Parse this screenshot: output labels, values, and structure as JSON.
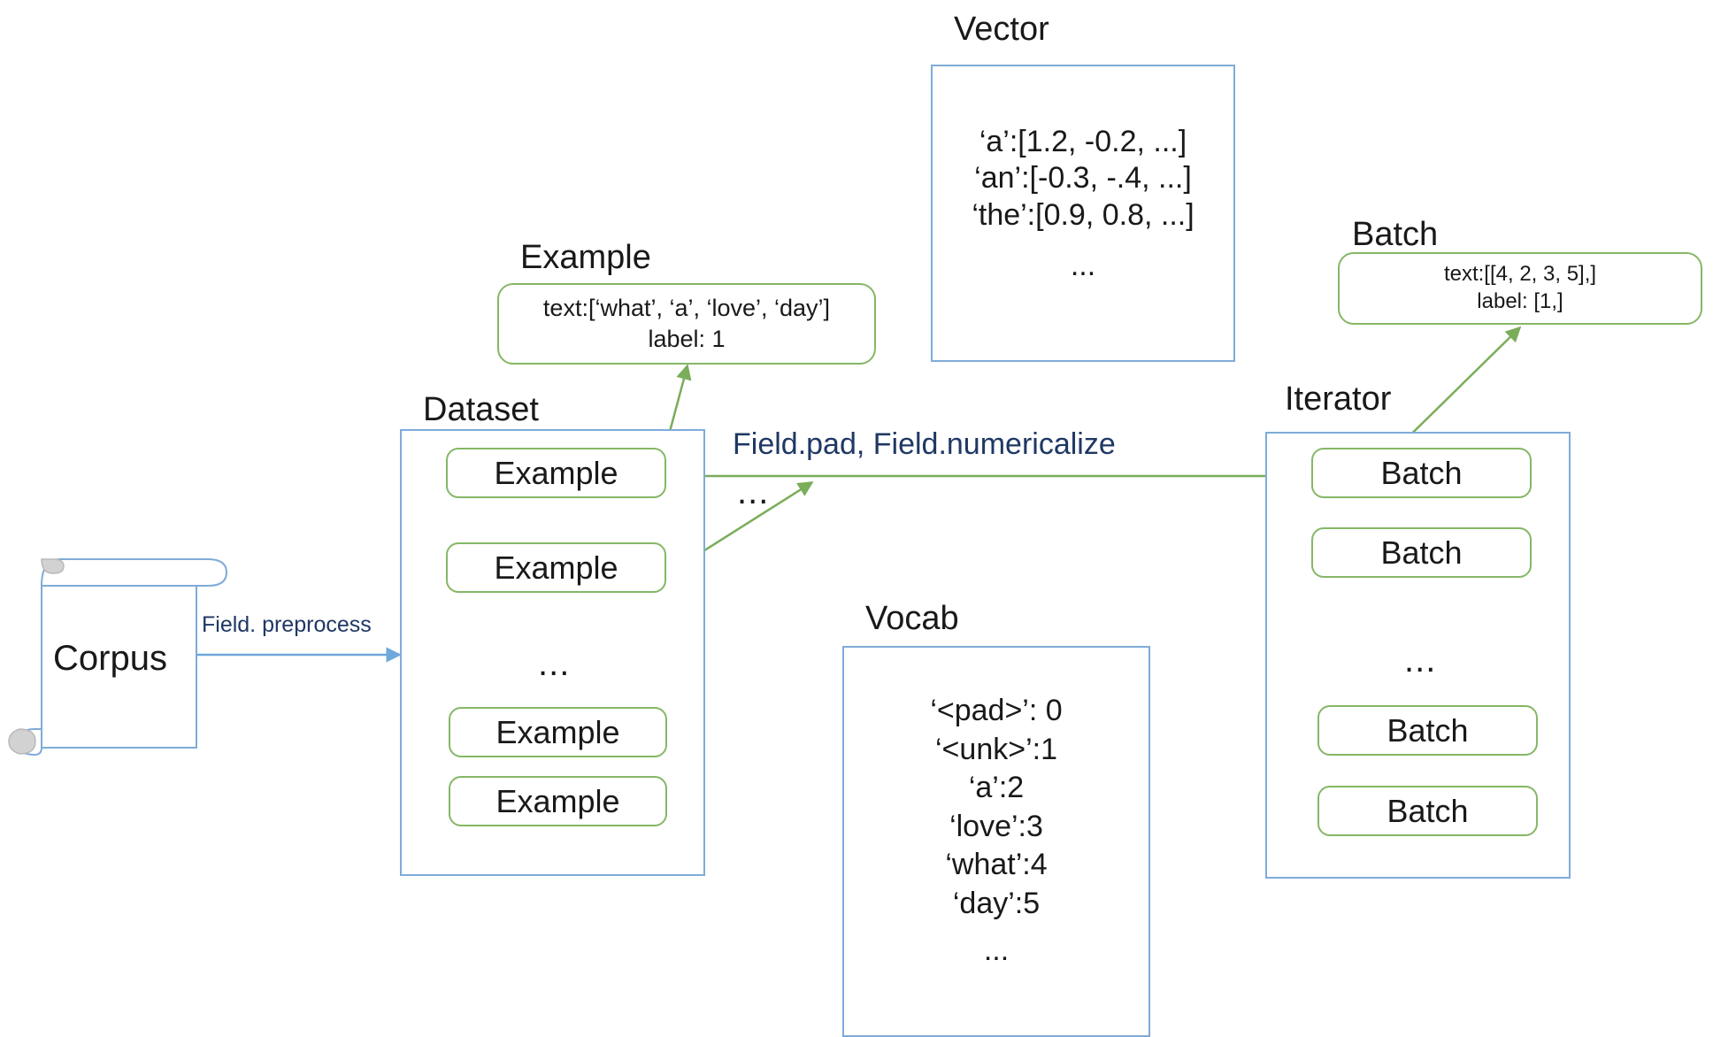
{
  "diagram": {
    "title_colors": {
      "blue_border": "#7fabd9",
      "green_border": "#85b766",
      "green_arrow": "#7aad5a",
      "blue_arrow": "#6fa8dc",
      "edge_label_navy": "#1f3864",
      "text_black": "#191919"
    }
  },
  "corpus": {
    "label": "Corpus"
  },
  "edges": {
    "preprocess_label": "Field. preprocess",
    "pad_numericalize_label": "Field.pad, Field.numericalize",
    "middle_ellipsis": "..."
  },
  "dataset": {
    "title": "Dataset",
    "items": [
      {
        "label": "Example"
      },
      {
        "label": "Example"
      },
      {
        "label": "Example"
      },
      {
        "label": "Example"
      }
    ],
    "ellipsis": "..."
  },
  "example_detail": {
    "title": "Example",
    "lines": [
      "text:[‘what’, ‘a’, ‘love’, ‘day’]",
      "label: 1"
    ]
  },
  "vector": {
    "title": "Vector",
    "lines": [
      "‘a’:[1.2, -0.2, ...]",
      "‘an’:[-0.3, -.4, ...]",
      "‘the’:[0.9, 0.8, ...]"
    ],
    "ellipsis": "..."
  },
  "vocab": {
    "title": "Vocab",
    "lines": [
      "‘<pad>’: 0",
      "‘<unk>’:1",
      "‘a’:2",
      "‘love’:3",
      "‘what’:4",
      "‘day’:5"
    ],
    "ellipsis": "..."
  },
  "iterator": {
    "title": "Iterator",
    "items": [
      {
        "label": "Batch"
      },
      {
        "label": "Batch"
      },
      {
        "label": "Batch"
      },
      {
        "label": "Batch"
      }
    ],
    "ellipsis": "..."
  },
  "batch_detail": {
    "title": "Batch",
    "lines": [
      "text:[[4, 2, 3, 5],]",
      "label: [1,]"
    ]
  }
}
